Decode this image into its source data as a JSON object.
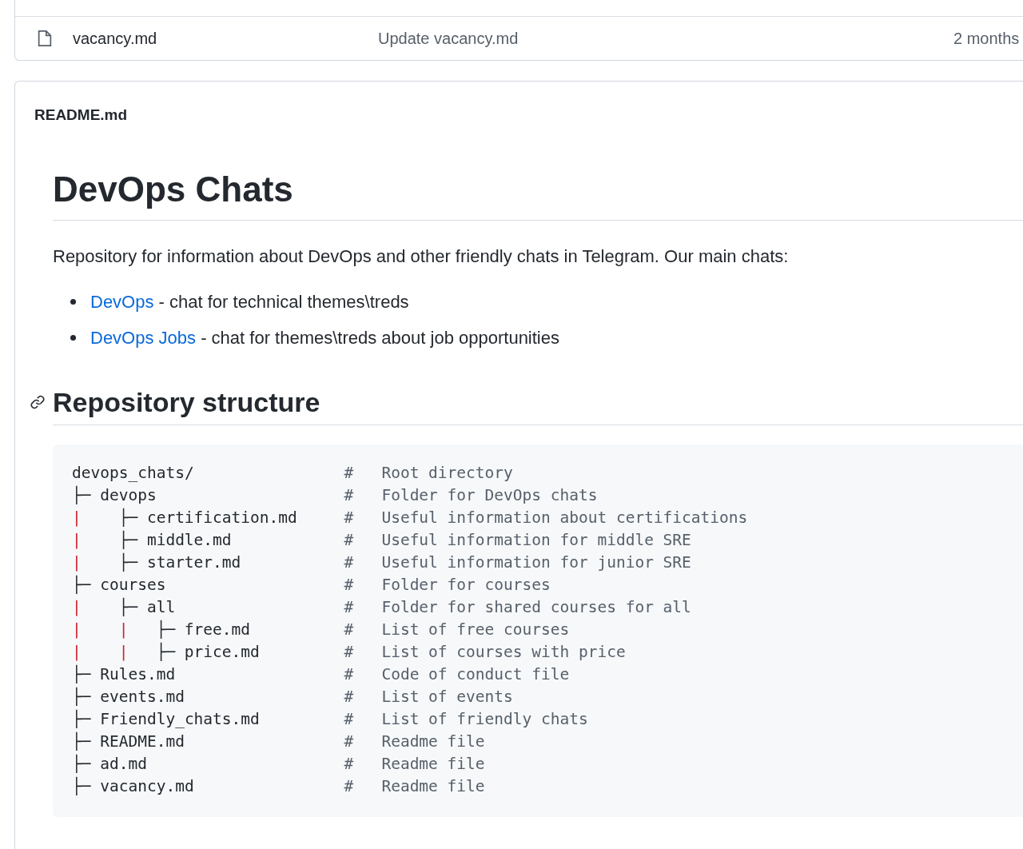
{
  "files": [
    {
      "name": "vacancy.md",
      "commit": "Update vacancy.md",
      "age": "2 months"
    }
  ],
  "readme": {
    "filename": "README.md",
    "title": "DevOps Chats",
    "intro": "Repository for information about DevOps and other friendly chats in Telegram. Our main chats:",
    "links": [
      {
        "link": "DevOps",
        "text": " - chat for technical themes\\treds"
      },
      {
        "link": "DevOps Jobs",
        "text": " - chat for themes\\treds about job opportunities"
      }
    ],
    "section_title": "Repository structure",
    "code": [
      {
        "parts": [
          {
            "kind": "plain",
            "text": "devops_chats/"
          }
        ],
        "marker": "#",
        "comment": "Root directory"
      },
      {
        "parts": [
          {
            "kind": "plain",
            "text": "├─ devops"
          }
        ],
        "marker": "#",
        "comment": "Folder for DevOps chats"
      },
      {
        "parts": [
          {
            "kind": "error",
            "text": "|"
          },
          {
            "kind": "plain",
            "text": "├─ certification.md"
          }
        ],
        "marker": "#",
        "comment": "Useful information about certifications"
      },
      {
        "parts": [
          {
            "kind": "error",
            "text": "|"
          },
          {
            "kind": "plain",
            "text": "├─ middle.md"
          }
        ],
        "marker": "#",
        "comment": "Useful information for middle SRE"
      },
      {
        "parts": [
          {
            "kind": "error",
            "text": "|"
          },
          {
            "kind": "plain",
            "text": "├─ starter.md"
          }
        ],
        "marker": "#",
        "comment": "Useful information for junior SRE"
      },
      {
        "parts": [
          {
            "kind": "plain",
            "text": "├─ courses"
          }
        ],
        "marker": "#",
        "comment": "Folder for courses"
      },
      {
        "parts": [
          {
            "kind": "error",
            "text": "|"
          },
          {
            "kind": "plain",
            "text": "├─ all"
          }
        ],
        "marker": "#",
        "comment": "Folder for shared courses for all"
      },
      {
        "parts": [
          {
            "kind": "error",
            "text": "|"
          },
          {
            "kind": "error",
            "text": "|"
          },
          {
            "kind": "plain",
            "text": "├─ free.md"
          }
        ],
        "marker": "#",
        "comment": "List of free courses"
      },
      {
        "parts": [
          {
            "kind": "error",
            "text": "|"
          },
          {
            "kind": "error",
            "text": "|"
          },
          {
            "kind": "plain",
            "text": "├─ price.md"
          }
        ],
        "marker": "#",
        "comment": "List of courses with price"
      },
      {
        "parts": [
          {
            "kind": "plain",
            "text": "├─ Rules.md"
          }
        ],
        "marker": "#",
        "comment": "Code of conduct file"
      },
      {
        "parts": [
          {
            "kind": "plain",
            "text": "├─ events.md"
          }
        ],
        "marker": "#",
        "comment": "List of events"
      },
      {
        "parts": [
          {
            "kind": "plain",
            "text": "├─ Friendly_chats.md"
          }
        ],
        "marker": "#",
        "comment": "List of friendly chats"
      },
      {
        "parts": [
          {
            "kind": "plain",
            "text": "├─ README.md"
          }
        ],
        "marker": "#",
        "comment": "Readme file"
      },
      {
        "parts": [
          {
            "kind": "plain",
            "text": "├─ ad.md"
          }
        ],
        "marker": "#",
        "comment": "Readme file"
      },
      {
        "parts": [
          {
            "kind": "plain",
            "text": "├─ vacancy.md"
          }
        ],
        "marker": "#",
        "comment": "Readme file"
      }
    ]
  }
}
